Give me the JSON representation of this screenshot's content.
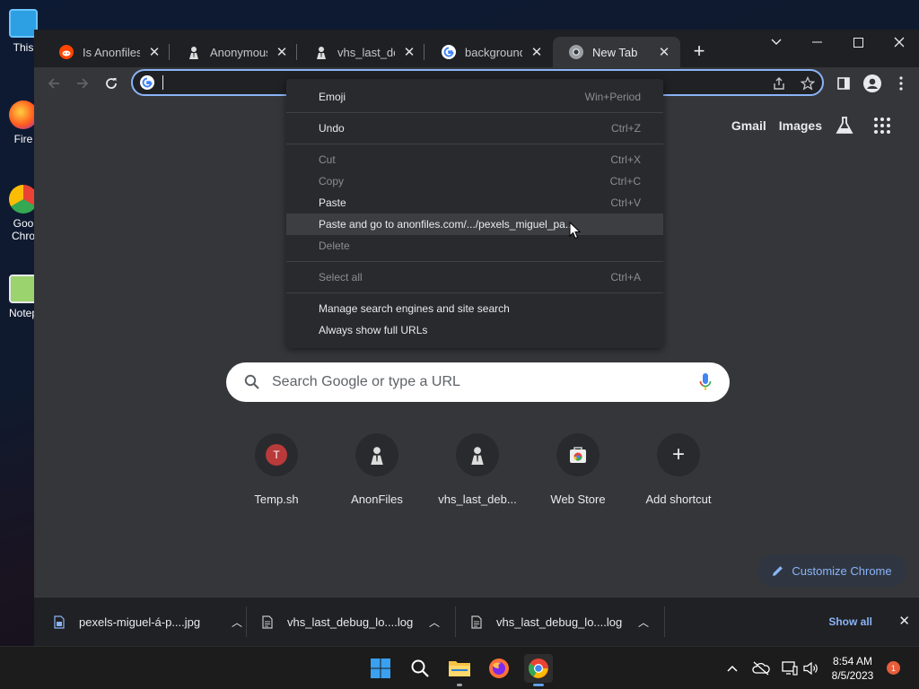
{
  "desktop": {
    "icons": [
      {
        "label": "This",
        "icon": "pc-icon"
      },
      {
        "label": "Fire",
        "icon": "firefox-icon"
      },
      {
        "label": "Goo Chro",
        "icon": "chrome-icon"
      },
      {
        "label": "Notep",
        "icon": "notepad-icon"
      }
    ]
  },
  "tabs": [
    {
      "title": "Is Anonfiles.co",
      "favicon": "reddit-icon",
      "active": false
    },
    {
      "title": "Anonymous Fi",
      "favicon": "anon-icon",
      "active": false
    },
    {
      "title": "vhs_last_debug",
      "favicon": "anon-icon",
      "active": false
    },
    {
      "title": "background - G",
      "favicon": "google-icon",
      "active": false
    },
    {
      "title": "New Tab",
      "favicon": "chrome-icon",
      "active": true
    }
  ],
  "omnibox": {
    "value": "",
    "placeholder": ""
  },
  "toplinks": {
    "gmail": "Gmail",
    "images": "Images"
  },
  "context_menu": {
    "items": [
      {
        "label": "Emoji",
        "shortcut": "Win+Period",
        "disabled": false
      },
      {
        "sep": true
      },
      {
        "label": "Undo",
        "shortcut": "Ctrl+Z",
        "disabled": false
      },
      {
        "sep": true
      },
      {
        "label": "Cut",
        "shortcut": "Ctrl+X",
        "disabled": true
      },
      {
        "label": "Copy",
        "shortcut": "Ctrl+C",
        "disabled": true
      },
      {
        "label": "Paste",
        "shortcut": "Ctrl+V",
        "disabled": false
      },
      {
        "label": "Paste and go to anonfiles.com/.../pexels_miguel_pa...",
        "shortcut": "",
        "disabled": false,
        "hover": true
      },
      {
        "label": "Delete",
        "shortcut": "",
        "disabled": true
      },
      {
        "sep": true
      },
      {
        "label": "Select all",
        "shortcut": "Ctrl+A",
        "disabled": true
      },
      {
        "sep": true
      },
      {
        "label": "Manage search engines and site search",
        "shortcut": "",
        "disabled": false
      },
      {
        "label": "Always show full URLs",
        "shortcut": "",
        "disabled": false
      }
    ]
  },
  "search": {
    "placeholder": "Search Google or type a URL"
  },
  "shortcuts": [
    {
      "name": "Temp.sh",
      "icon": "temp-sh-icon",
      "letter": "T"
    },
    {
      "name": "AnonFiles",
      "icon": "anon-icon",
      "letter": ""
    },
    {
      "name": "vhs_last_deb...",
      "icon": "anon-icon",
      "letter": ""
    },
    {
      "name": "Web Store",
      "icon": "web-store-icon",
      "letter": ""
    },
    {
      "name": "Add shortcut",
      "icon": "plus-icon",
      "letter": "+"
    }
  ],
  "customize": {
    "label": "Customize Chrome"
  },
  "downloads": {
    "items": [
      {
        "name": "pexels-miguel-á-p....jpg"
      },
      {
        "name": "vhs_last_debug_lo....log"
      },
      {
        "name": "vhs_last_debug_lo....log"
      }
    ],
    "show_all": "Show all"
  },
  "taskbar": {
    "time": "8:54 AM",
    "date": "8/5/2023",
    "notifications": "1"
  },
  "colors": {
    "accent": "#8ab4f8",
    "page_bg": "#35363a",
    "tab_bg": "#1f2023"
  }
}
